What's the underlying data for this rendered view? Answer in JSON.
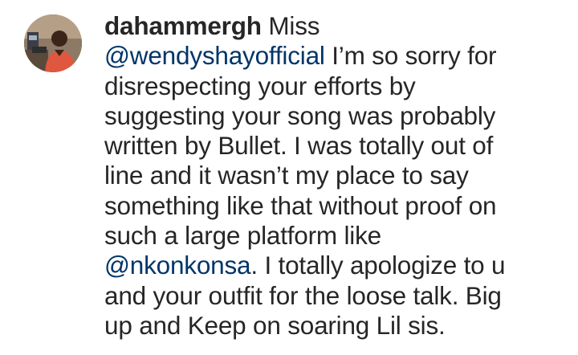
{
  "comment": {
    "username": "dahammergh",
    "lines": [
      [
        {
          "kind": "plain",
          "text": " Miss"
        }
      ],
      [
        {
          "kind": "mention",
          "text": "@wendyshayofficial"
        },
        {
          "kind": "plain",
          "text": " I’m so sorry for"
        }
      ],
      [
        {
          "kind": "plain",
          "text": "disrespecting your efforts by"
        }
      ],
      [
        {
          "kind": "plain",
          "text": "suggesting your song was probably"
        }
      ],
      [
        {
          "kind": "plain",
          "text": "written by Bullet. I was totally out of"
        }
      ],
      [
        {
          "kind": "plain",
          "text": "line and it wasn’t my place to say"
        }
      ],
      [
        {
          "kind": "plain",
          "text": "something like that without proof on"
        }
      ],
      [
        {
          "kind": "plain",
          "text": "such a large platform like"
        }
      ],
      [
        {
          "kind": "mention",
          "text": "@nkonkonsa"
        },
        {
          "kind": "plain",
          "text": ". I totally apologize to u"
        }
      ],
      [
        {
          "kind": "plain",
          "text": "and your outfit for the loose talk. Big"
        }
      ],
      [
        {
          "kind": "plain",
          "text": "up and Keep on soaring Lil sis."
        }
      ]
    ]
  },
  "colors": {
    "text": "#262626",
    "mention": "#003569",
    "background": "#ffffff"
  }
}
